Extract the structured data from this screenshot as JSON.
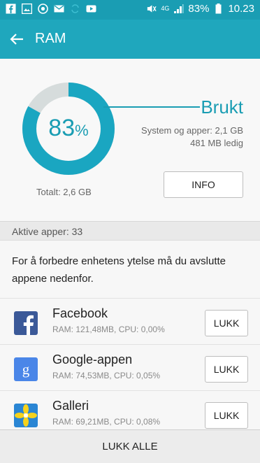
{
  "status_bar": {
    "network": "4G",
    "battery": "83%",
    "time": "10.23"
  },
  "app_bar": {
    "title": "RAM"
  },
  "ram": {
    "percent": "83",
    "percent_sign": "%",
    "used_fraction": 0.83,
    "used_label": "Brukt",
    "system_apps": "System og apper: 2,1 GB",
    "free": "481 MB ledig",
    "total": "Totalt: 2,6 GB",
    "info_button": "INFO"
  },
  "active_apps": {
    "header": "Aktive apper: 33",
    "description": "For å forbedre enhetens ytelse må du avslutte appene nedenfor."
  },
  "apps": [
    {
      "name": "Facebook",
      "meta": "RAM: 121,48MB, CPU: 0,00%",
      "button": "LUKK",
      "icon": "facebook-icon"
    },
    {
      "name": "Google-appen",
      "meta": "RAM: 74,53MB, CPU: 0,05%",
      "button": "LUKK",
      "icon": "google-icon"
    },
    {
      "name": "Galleri",
      "meta": "RAM: 69,21MB, CPU: 0,08%",
      "button": "LUKK",
      "icon": "gallery-icon"
    }
  ],
  "bottom": {
    "close_all": "LUKK ALLE"
  },
  "colors": {
    "accent": "#1fa7bd",
    "status_bar": "#1a9db3",
    "donut_used": "#1aa6c1",
    "donut_free": "#d6dcdc"
  }
}
